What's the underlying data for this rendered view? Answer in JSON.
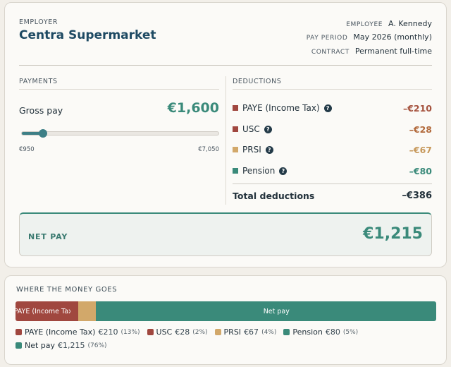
{
  "header": {
    "employer_label": "EMPLOYER",
    "employer_name": "Centra Supermarket",
    "employee_label": "EMPLOYEE",
    "employee_value": "A. Kennedy",
    "pay_period_label": "PAY PERIOD",
    "pay_period_value": "May 2026 (monthly)",
    "contract_label": "CONTRACT",
    "contract_value": "Permanent full-time"
  },
  "payments": {
    "section_label": "PAYMENTS",
    "gross_label": "Gross pay",
    "gross_value": "€1,600",
    "slider": {
      "min_label": "€950",
      "max_label": "€7,050",
      "min": 950,
      "max": 7050,
      "value": 1600
    }
  },
  "deductions": {
    "section_label": "DEDUCTIONS",
    "items": [
      {
        "name": "PAYE (Income Tax)",
        "amount": "–€210",
        "color": "#a0473f",
        "amount_color": "#a5523e",
        "icon": "help-icon"
      },
      {
        "name": "USC",
        "amount": "–€28",
        "color": "#a0473f",
        "amount_color": "#b26a3c",
        "icon": "help-icon"
      },
      {
        "name": "PRSI",
        "amount": "–€67",
        "color": "#d2a86a",
        "amount_color": "#c7995c",
        "icon": "help-icon"
      },
      {
        "name": "Pension",
        "amount": "–€80",
        "color": "#3a8a7a",
        "amount_color": "#3a8a7a",
        "icon": "help-icon"
      }
    ],
    "help_glyph": "?",
    "total_label": "Total deductions",
    "total_amount": "–€386"
  },
  "net_pay": {
    "label": "NET PAY",
    "value": "€1,215"
  },
  "breakdown": {
    "title": "WHERE THE MONEY GOES",
    "segments": [
      {
        "name": "PAYE (Income Tax)",
        "value": 210,
        "label": "PAYE (Income Tax",
        "color": "#a0473f"
      },
      {
        "name": "USC",
        "value": 28,
        "label": "",
        "color": "#a0473f"
      },
      {
        "name": "PRSI",
        "value": 67,
        "label": "",
        "color": "#d2a86a"
      },
      {
        "name": "Pension",
        "value": 80,
        "label": "",
        "color": "#3a8a7a"
      },
      {
        "name": "Net pay",
        "value": 1215,
        "label": "Net pay",
        "color": "#3a8a7a"
      }
    ],
    "legend": [
      {
        "name": "PAYE (Income Tax)",
        "amount": "€210",
        "pct": "(13%)",
        "color": "#a0473f"
      },
      {
        "name": "USC",
        "amount": "€28",
        "pct": "(2%)",
        "color": "#a0473f"
      },
      {
        "name": "PRSI",
        "amount": "€67",
        "pct": "(4%)",
        "color": "#d2a86a"
      },
      {
        "name": "Pension",
        "amount": "€80",
        "pct": "(5%)",
        "color": "#3a8a7a"
      },
      {
        "name": "Net pay",
        "amount": "€1,215",
        "pct": "(76%)",
        "color": "#3a8a7a"
      }
    ]
  }
}
